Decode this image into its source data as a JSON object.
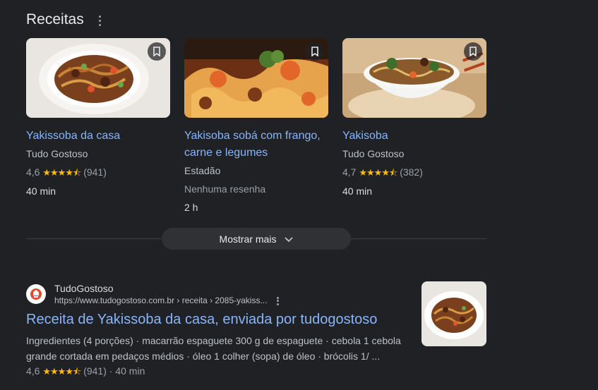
{
  "recipes": {
    "heading": "Receitas",
    "cards": [
      {
        "title": "Yakissoba da casa",
        "source": "Tudo Gostoso",
        "rating": "4,6",
        "stars": "★★★★⯪",
        "reviews": "(941)",
        "duration": "40 min"
      },
      {
        "title": "Yakisoba sobá com frango, carne e legumes",
        "source": "Estadão",
        "no_reviews": "Nenhuma resenha",
        "duration": "2 h"
      },
      {
        "title": "Yakisoba",
        "source": "Tudo Gostoso",
        "rating": "4,7",
        "stars": "★★★★⯪",
        "reviews": "(382)",
        "duration": "40 min"
      }
    ],
    "show_more": "Mostrar mais"
  },
  "result": {
    "site_name": "TudoGostoso",
    "url": "https://www.tudogostoso.com.br › receita › 2085-yakiss...",
    "title": "Receita de Yakissoba da casa, enviada por tudogostoso",
    "snippet": "Ingredientes (4 porções) · macarrão espaguete 300 g de espaguete · cebola 1 cebola grande cortada em pedaços médios · óleo 1 colher (sopa) de óleo · brócolis 1/ ...",
    "rating": "4,6",
    "stars": "★★★★⯪",
    "reviews": "(941)",
    "separator": "·",
    "duration": "40 min"
  },
  "colors": {
    "link": "#8ab4f8",
    "star": "#fbbc04",
    "background": "#202124"
  },
  "icons": [
    "more-vert-icon",
    "bookmark-icon",
    "chevron-down-icon",
    "chef-hat-favicon"
  ]
}
